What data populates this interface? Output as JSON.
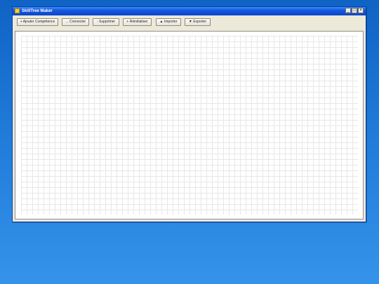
{
  "window": {
    "title": "SkillTree Maker",
    "controls": {
      "minimize": "_",
      "maximize": "□",
      "close": "×"
    }
  },
  "toolbar": {
    "add_skill": "+ Ajouter Compétence",
    "connect": "→ Connecter",
    "delete": "- Supprimer",
    "reset": "+ Réinitialiser",
    "import": "▲ Importer",
    "export": "▼ Exporter"
  },
  "icons": {
    "app": "app-icon"
  },
  "colors": {
    "titlebar": "#0b45c8",
    "desktop": "#1f7ad8",
    "window_background": "#ece9d8",
    "canvas": "#ffffff",
    "grid_line": "#e7e7e7"
  }
}
